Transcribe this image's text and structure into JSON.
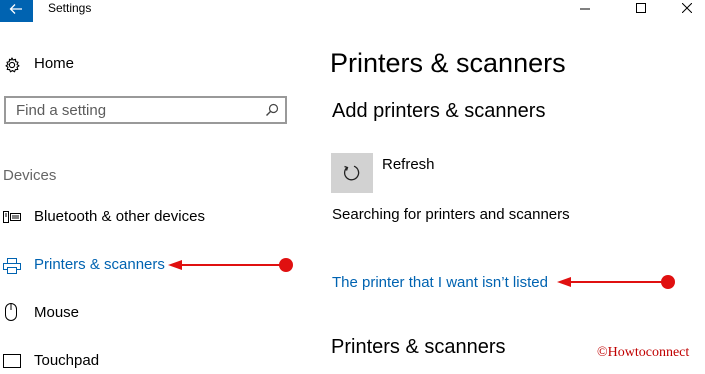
{
  "window": {
    "title": "Settings",
    "controls": [
      "minimize",
      "maximize",
      "close"
    ]
  },
  "sidebar": {
    "home_label": "Home",
    "search_placeholder": "Find a setting",
    "section_heading": "Devices",
    "items": [
      {
        "label": "Bluetooth & other devices",
        "icon": "bluetooth-devices-icon",
        "active": false
      },
      {
        "label": "Printers & scanners",
        "icon": "printer-icon",
        "active": true
      },
      {
        "label": "Mouse",
        "icon": "mouse-icon",
        "active": false
      },
      {
        "label": "Touchpad",
        "icon": "touchpad-icon",
        "active": false
      }
    ]
  },
  "main": {
    "title": "Printers & scanners",
    "add_heading": "Add printers & scanners",
    "refresh_label": "Refresh",
    "status_text": "Searching for printers and scanners",
    "not_listed_link": "The printer that I want isn’t listed",
    "section2_heading": "Printers & scanners"
  },
  "watermark": "©Howtoconnect",
  "colors": {
    "accent": "#0063b1",
    "annotation": "#e01010",
    "tile": "#d2d2d2"
  }
}
